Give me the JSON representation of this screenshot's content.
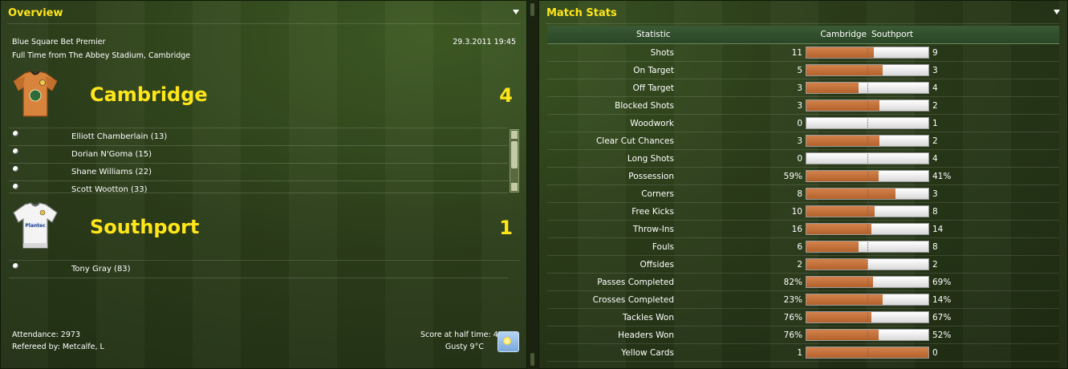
{
  "overview": {
    "title": "Overview",
    "competition": "Blue Square Bet Premier",
    "datetime": "29.3.2011 19:45",
    "result_line": "Full Time from The Abbey Stadium, Cambridge",
    "home": {
      "name": "Cambridge",
      "score": "4",
      "kit_icon": "orange-shirt-icon",
      "scorers": [
        "Elliott Chamberlain (13)",
        "Dorian N'Goma (15)",
        "Shane Williams (22)",
        "Scott Wootton (33)"
      ]
    },
    "away": {
      "name": "Southport",
      "score": "1",
      "kit_icon": "white-shirt-icon",
      "scorers": [
        "Tony Gray (83)"
      ]
    },
    "attendance": "Attendance: 2973",
    "referee": "Refereed by: Metcalfe, L",
    "half_time": "Score at half time: 4:0",
    "weather": "Gusty 9°C",
    "weather_icon": "sunny-weather-icon"
  },
  "stats": {
    "title": "Match Stats",
    "columns": {
      "statistic": "Statistic",
      "home": "Cambridge",
      "away": "Southport"
    },
    "colors": {
      "home_bar": "#c06a30",
      "away_bar": "#f0f0f0",
      "title": "#ffe61a"
    },
    "rows": [
      {
        "label": "Shots",
        "home": "11",
        "away": "9",
        "home_share": 0.55
      },
      {
        "label": "On Target",
        "home": "5",
        "away": "3",
        "home_share": 0.625
      },
      {
        "label": "Off Target",
        "home": "3",
        "away": "4",
        "home_share": 0.43
      },
      {
        "label": "Blocked Shots",
        "home": "3",
        "away": "2",
        "home_share": 0.6
      },
      {
        "label": "Woodwork",
        "home": "0",
        "away": "1",
        "home_share": 0.0
      },
      {
        "label": "Clear Cut Chances",
        "home": "3",
        "away": "2",
        "home_share": 0.6
      },
      {
        "label": "Long Shots",
        "home": "0",
        "away": "4",
        "home_share": 0.0
      },
      {
        "label": "Possession",
        "home": "59%",
        "away": "41%",
        "home_share": 0.59
      },
      {
        "label": "Corners",
        "home": "8",
        "away": "3",
        "home_share": 0.727
      },
      {
        "label": "Free Kicks",
        "home": "10",
        "away": "8",
        "home_share": 0.556
      },
      {
        "label": "Throw-Ins",
        "home": "16",
        "away": "14",
        "home_share": 0.533
      },
      {
        "label": "Fouls",
        "home": "6",
        "away": "8",
        "home_share": 0.43
      },
      {
        "label": "Offsides",
        "home": "2",
        "away": "2",
        "home_share": 0.5
      },
      {
        "label": "Passes Completed",
        "home": "82%",
        "away": "69%",
        "home_share": 0.543
      },
      {
        "label": "Crosses Completed",
        "home": "23%",
        "away": "14%",
        "home_share": 0.622
      },
      {
        "label": "Tackles Won",
        "home": "76%",
        "away": "67%",
        "home_share": 0.531
      },
      {
        "label": "Headers Won",
        "home": "76%",
        "away": "52%",
        "home_share": 0.594
      },
      {
        "label": "Yellow Cards",
        "home": "1",
        "away": "0",
        "home_share": 1.0
      }
    ]
  }
}
